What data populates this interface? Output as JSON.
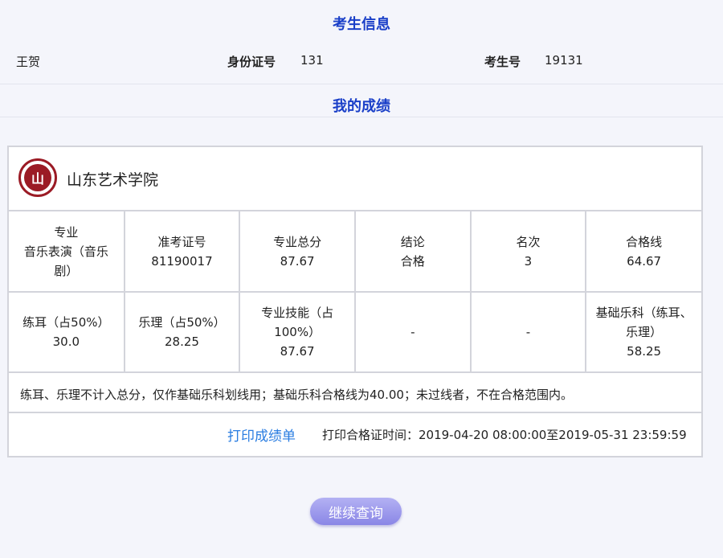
{
  "examinee_section": {
    "title": "考生信息",
    "name": "王贺",
    "id_label": "身份证号",
    "id_value": "131",
    "exam_no_label": "考生号",
    "exam_no_value": "19131"
  },
  "score_section": {
    "title": "我的成绩"
  },
  "school": {
    "name": "山东艺术学院",
    "logo_char": "山"
  },
  "row1": [
    {
      "label": "专业",
      "value": "音乐表演（音乐剧）"
    },
    {
      "label": "准考证号",
      "value": "81190017"
    },
    {
      "label": "专业总分",
      "value": "87.67"
    },
    {
      "label": "结论",
      "value": "合格"
    },
    {
      "label": "名次",
      "value": "3"
    },
    {
      "label": "合格线",
      "value": "64.67"
    }
  ],
  "row2": [
    {
      "label": "练耳（占50%）",
      "value": "30.0"
    },
    {
      "label": "乐理（占50%）",
      "value": "28.25"
    },
    {
      "label": "专业技能（占100%）",
      "value": "87.67"
    },
    {
      "label": "",
      "value": "-"
    },
    {
      "label": "",
      "value": "-"
    },
    {
      "label": "基础乐科（练耳、乐理）",
      "value": "58.25"
    }
  ],
  "note": "练耳、乐理不计入总分，仅作基础乐科划线用；基础乐科合格线为40.00；未过线者，不在合格范围内。",
  "print": {
    "link_label": "打印成绩单",
    "time_text": "打印合格证时间：2019-04-20 08:00:00至2019-05-31 23:59:59"
  },
  "continue_label": "继续查询"
}
